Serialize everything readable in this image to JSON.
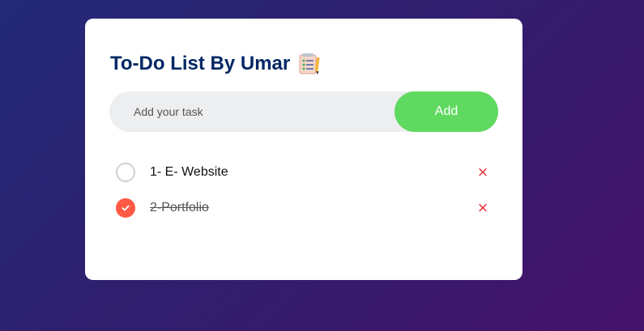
{
  "app": {
    "title": "To-Do List By Umar",
    "title_icon": "notepad-list-icon"
  },
  "input": {
    "value": "",
    "placeholder": "Add your task"
  },
  "add_button": {
    "label": "Add"
  },
  "tasks": [
    {
      "text": "1- E- Website",
      "checked": false,
      "delete_glyph": "×"
    },
    {
      "text": "2-Portfolio",
      "checked": true,
      "delete_glyph": "×"
    }
  ],
  "colors": {
    "title": "#002765",
    "add_button": "#5fd95f",
    "checked": "#ff5945",
    "delete": "#e0262b"
  }
}
